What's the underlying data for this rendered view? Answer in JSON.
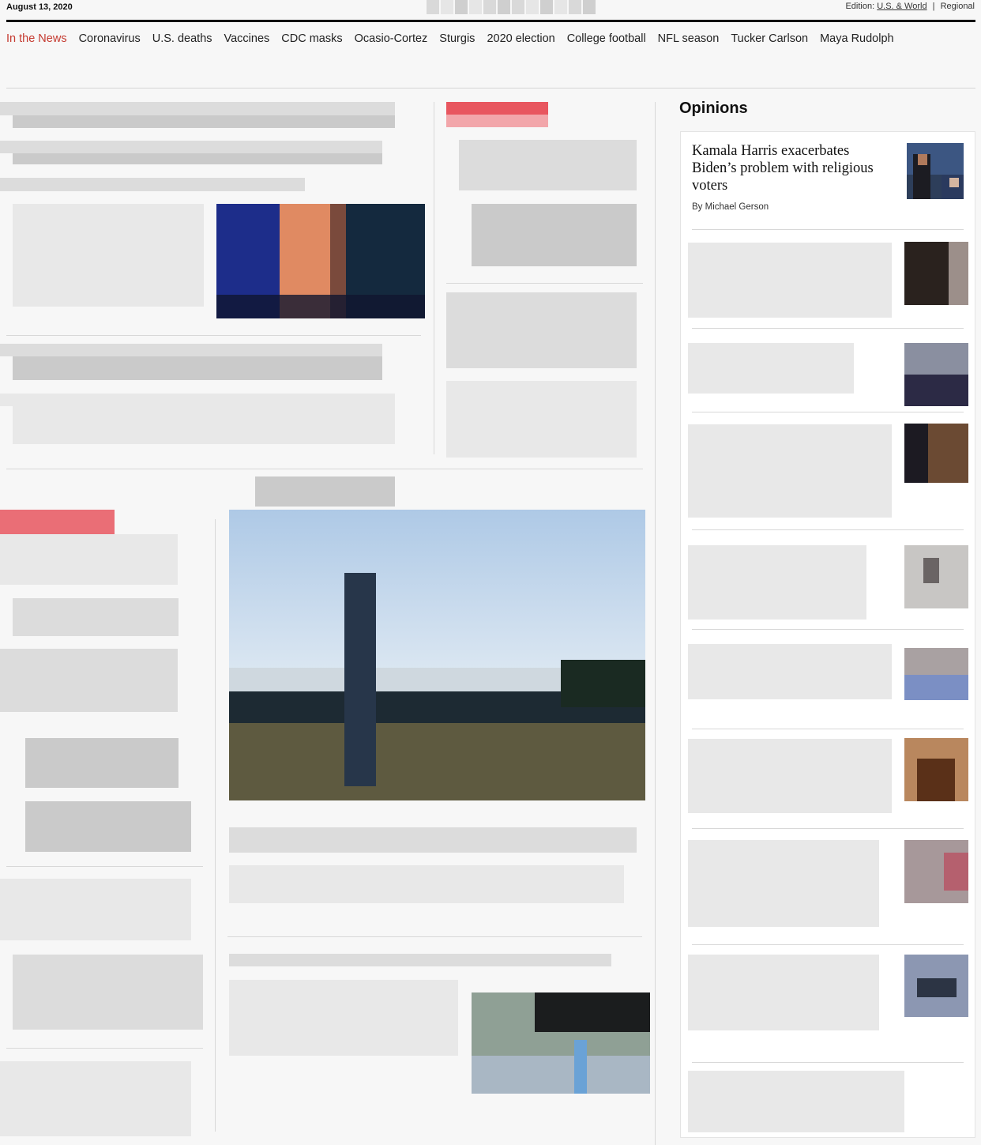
{
  "header": {
    "date": "August 13, 2020",
    "edition_label": "Edition:",
    "edition_current": "U.S. & World",
    "edition_separator": "|",
    "edition_other": "Regional"
  },
  "nav": {
    "items": [
      "In the News",
      "Coronavirus",
      "U.S. deaths",
      "Vaccines",
      "CDC masks",
      "Ocasio-Cortez",
      "Sturgis",
      "2020 election",
      "College football",
      "NFL season",
      "Tucker Carlson",
      "Maya Rudolph"
    ]
  },
  "opinions": {
    "title": "Opinions",
    "feature": {
      "headline": "Kamala Harris exacerbates Biden’s problem with religious voters",
      "byline": "By Michael Gerson"
    }
  },
  "colors": {
    "accent_red": "#c53a30",
    "page_bg": "#f7f7f7"
  }
}
